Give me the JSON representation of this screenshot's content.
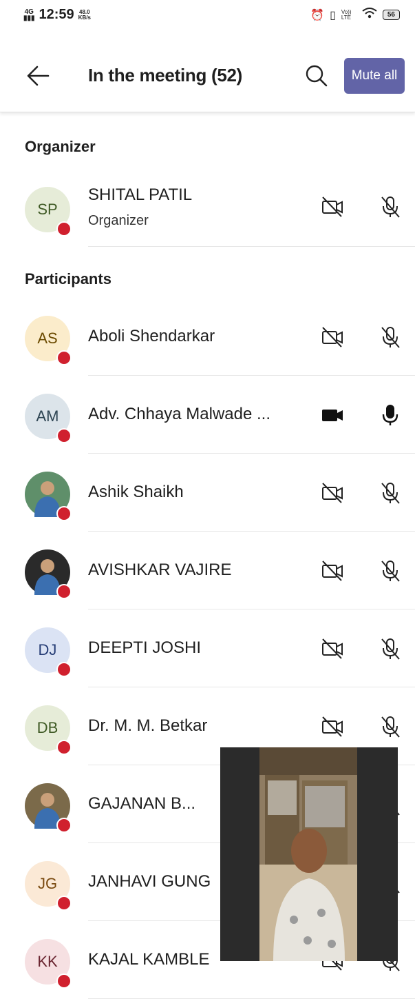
{
  "status_bar": {
    "network": "4G",
    "time": "12:59",
    "speed_value": "48.0",
    "speed_unit": "KB/s",
    "volte": "Vo)) LTE",
    "battery": "56"
  },
  "header": {
    "title": "In the meeting (52)",
    "mute_all": "Mute all"
  },
  "organizer_section": {
    "title": "Organizer"
  },
  "organizer": {
    "initials": "SP",
    "name": "SHITAL PATIL",
    "role": "Organizer",
    "avatar_bg": "#e6ecd8",
    "initials_color": "#3f5a25"
  },
  "participants_section": {
    "title": "Participants"
  },
  "participants": [
    {
      "initials": "AS",
      "name": "Aboli Shendarkar",
      "avatar_bg": "#fbeccb",
      "initials_color": "#6b4a00",
      "camera": "off",
      "mic": "off"
    },
    {
      "initials": "AM",
      "name": "Adv. Chhaya Malwade ...",
      "avatar_bg": "#dce4ea",
      "initials_color": "#2d4452",
      "camera": "on",
      "mic": "on"
    },
    {
      "initials": "",
      "name": "Ashik Shaikh",
      "avatar_bg": "#5f8f6a",
      "camera": "off",
      "mic": "off",
      "photo": true
    },
    {
      "initials": "",
      "name": "AVISHKAR VAJIRE",
      "avatar_bg": "#2a2a2a",
      "camera": "off",
      "mic": "off",
      "photo": true
    },
    {
      "initials": "DJ",
      "name": "DEEPTI JOSHI",
      "avatar_bg": "#dbe3f4",
      "initials_color": "#253c75",
      "camera": "off",
      "mic": "off"
    },
    {
      "initials": "DB",
      "name": "Dr. M. M. Betkar",
      "avatar_bg": "#e6ecd8",
      "initials_color": "#3f5a25",
      "camera": "off",
      "mic": "off"
    },
    {
      "initials": "",
      "name": "GAJANAN B...",
      "avatar_bg": "#7b6a4a",
      "camera": "off",
      "mic": "off",
      "photo": true
    },
    {
      "initials": "JG",
      "name": "JANHAVI GUNG",
      "avatar_bg": "#fbe9d6",
      "initials_color": "#7a4a10",
      "camera": "off",
      "mic": "off"
    },
    {
      "initials": "KK",
      "name": "KAJAL KAMBLE",
      "avatar_bg": "#f6e0e2",
      "initials_color": "#6a2530",
      "camera": "off",
      "mic": "off"
    }
  ],
  "colors": {
    "accent": "#6264a7",
    "presence_busy": "#d0202e"
  }
}
